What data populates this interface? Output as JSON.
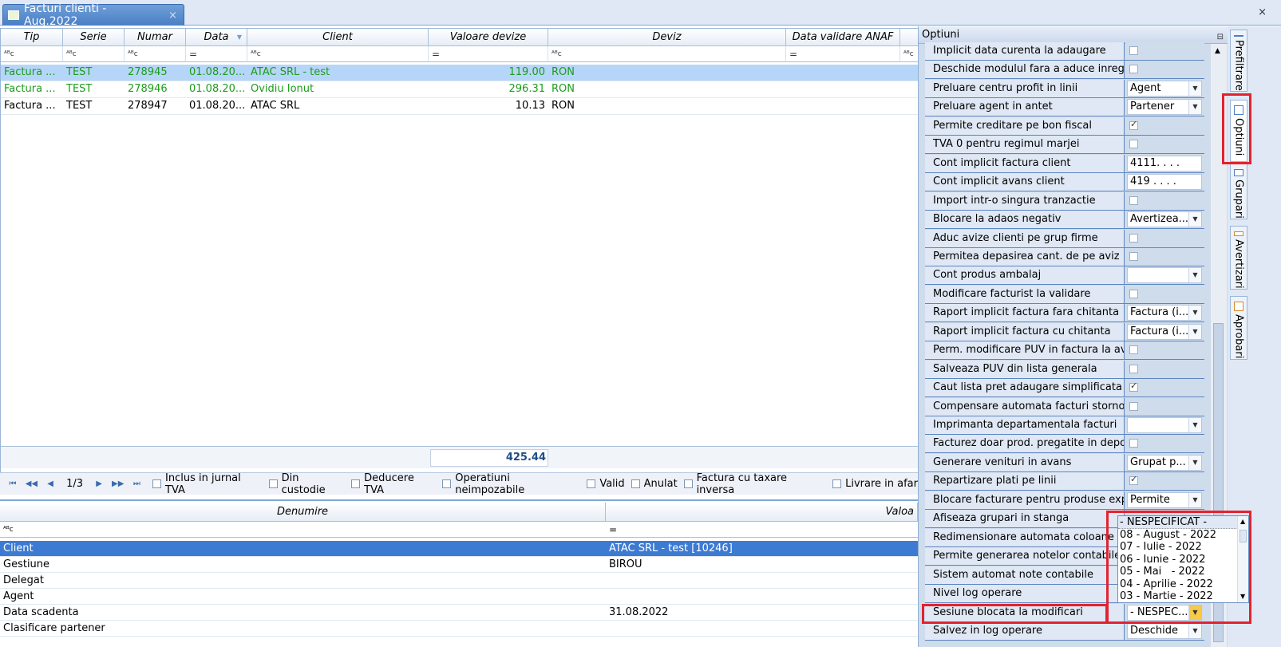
{
  "tab": {
    "title": "Facturi clienti - Aug.2022",
    "close": "×"
  },
  "window": {
    "close": "×"
  },
  "grid": {
    "columns": [
      "Tip",
      "Serie",
      "Numar",
      "Data",
      "Client",
      "Valoare devize",
      "Deviz",
      "Data validare ANAF"
    ],
    "filters": [
      "ᴬᴮc",
      "ᴬᴮc",
      "ᴬᴮc",
      "=",
      "ᴬᴮc",
      "=",
      "ᴬᴮc",
      "=",
      "ᴬᴮc"
    ],
    "rows": [
      {
        "tip": "Factura ...",
        "serie": "TEST",
        "numar": "278945",
        "data": "01.08.20...",
        "client": "ATAC SRL - test",
        "valoare": "119.00",
        "deviz": "RON",
        "anaf": ""
      },
      {
        "tip": "Factura ...",
        "serie": "TEST",
        "numar": "278946",
        "data": "01.08.20...",
        "client": "Ovidiu Ionut",
        "valoare": "296.31",
        "deviz": "RON",
        "anaf": ""
      },
      {
        "tip": "Factura ...",
        "serie": "TEST",
        "numar": "278947",
        "data": "01.08.20...",
        "client": "ATAC SRL",
        "valoare": "10.13",
        "deviz": "RON",
        "anaf": ""
      }
    ],
    "total": "425.44"
  },
  "nav": {
    "page": "1/3",
    "first": "⏮",
    "prev_page": "◀◀",
    "prev": "◀",
    "next": "▶",
    "next_page": "▶▶",
    "last": "⏭",
    "checks": [
      "Inclus in jurnal TVA",
      "Din custodie",
      "Deducere TVA",
      "Operatiuni neimpozabile",
      "Valid",
      "Anulat",
      "Factura cu taxare inversa",
      "Livrare in afar"
    ]
  },
  "lower": {
    "columns": [
      "Denumire",
      "Valoa"
    ],
    "filters": [
      "ᴬᴮc",
      "="
    ],
    "rows": [
      {
        "name": "Client",
        "value": "ATAC SRL - test [10246]"
      },
      {
        "name": "Gestiune",
        "value": "BIROU"
      },
      {
        "name": "Delegat",
        "value": ""
      },
      {
        "name": "Agent",
        "value": ""
      },
      {
        "name": "Data scadenta",
        "value": "31.08.2022"
      },
      {
        "name": "Clasificare partener",
        "value": ""
      }
    ]
  },
  "options": {
    "title": "Optiuni",
    "pin": "⊟",
    "rows": [
      {
        "label": "Implicit data curenta la adaugare",
        "type": "check",
        "checked": false
      },
      {
        "label": "Deschide modulul fara a aduce inregis",
        "type": "check",
        "checked": false
      },
      {
        "label": "Preluare centru profit in linii",
        "type": "combo",
        "value": "Agent"
      },
      {
        "label": "Preluare agent in antet",
        "type": "combo",
        "value": "Partener"
      },
      {
        "label": "Permite creditare pe bon fiscal",
        "type": "check",
        "checked": true
      },
      {
        "label": "TVA 0 pentru regimul marjei",
        "type": "check",
        "checked": false
      },
      {
        "label": "Cont implicit factura client",
        "type": "text",
        "value": "4111. . . ."
      },
      {
        "label": "Cont implicit avans client",
        "type": "text",
        "value": "419 . . . ."
      },
      {
        "label": "Import intr-o singura tranzactie",
        "type": "check",
        "checked": false
      },
      {
        "label": "Blocare la adaos negativ",
        "type": "combo",
        "value": "Avertizea..."
      },
      {
        "label": "Aduc avize clienti pe grup firme",
        "type": "check",
        "checked": false
      },
      {
        "label": "Permitea depasirea cant. de pe aviz",
        "type": "check",
        "checked": false
      },
      {
        "label": "Cont produs ambalaj",
        "type": "combo",
        "value": ""
      },
      {
        "label": "Modificare facturist la validare",
        "type": "check",
        "checked": false
      },
      {
        "label": "Raport implicit factura fara chitanta",
        "type": "combo",
        "value": "Factura (i..."
      },
      {
        "label": "Raport implicit factura cu chitanta",
        "type": "combo",
        "value": "Factura (i..."
      },
      {
        "label": "Perm. modificare PUV in factura la av",
        "type": "check",
        "checked": false
      },
      {
        "label": "Salveaza PUV din lista generala",
        "type": "check",
        "checked": false
      },
      {
        "label": "Caut lista pret adaugare simplificata",
        "type": "check",
        "checked": true
      },
      {
        "label": "Compensare automata facturi storno",
        "type": "check",
        "checked": false
      },
      {
        "label": "Imprimanta departamentala facturi",
        "type": "combo",
        "value": ""
      },
      {
        "label": "Facturez doar prod. pregatite in depo",
        "type": "check",
        "checked": false
      },
      {
        "label": "Generare venituri in avans",
        "type": "combo",
        "value": "Grupat p..."
      },
      {
        "label": "Repartizare plati pe linii",
        "type": "check",
        "checked": true
      },
      {
        "label": "Blocare facturare pentru produse exp",
        "type": "combo",
        "value": "Permite"
      },
      {
        "label": "Afiseaza grupari in stanga",
        "type": "none",
        "value": ""
      },
      {
        "label": "Redimensionare automata coloane",
        "type": "none",
        "value": ""
      },
      {
        "label": "Permite generarea notelor contabile",
        "type": "none",
        "value": ""
      },
      {
        "label": "Sistem automat note contabile",
        "type": "none",
        "value": ""
      },
      {
        "label": "Nivel log operare",
        "type": "none",
        "value": ""
      },
      {
        "label": "Sesiune blocata la modificari",
        "type": "combo",
        "value": "- NESPEC..."
      },
      {
        "label": "Salvez in log operare",
        "type": "combo",
        "value": "Deschide"
      }
    ]
  },
  "dropdown": {
    "items": [
      "- NESPECIFICAT -",
      "08 - August - 2022",
      "07 - Iulie - 2022",
      "06 - Iunie - 2022",
      "05 - Mai   - 2022",
      "04 - Aprilie - 2022",
      "03 - Martie - 2022"
    ],
    "up": "▲",
    "down": "▼"
  },
  "sidetabs": [
    "Prefiltrare",
    "Optiuni",
    "Grupari",
    "Avertizari",
    "Aprobari"
  ],
  "colors": {
    "accent": "#4a7fc4",
    "highlight": "#e2232f",
    "selected_row": "#b5d6f8",
    "green_text": "#1c9c1c"
  }
}
